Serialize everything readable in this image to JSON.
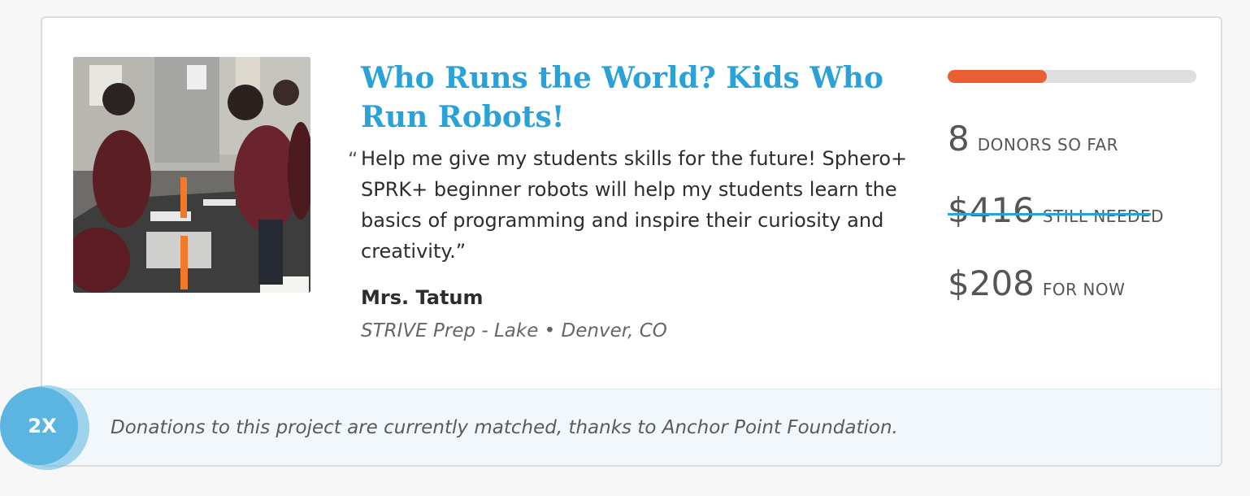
{
  "project": {
    "title": "Who Runs the World? Kids Who Run Robots!",
    "quote_open": "“",
    "quote": "Help me give my students skills for the future! Sphero+ SPRK+ beginner robots will help my students learn the basics of programming and inspire their curiosity and creativity.”",
    "teacher": "Mrs. Tatum",
    "school": "STRIVE Prep - Lake • Denver, CO",
    "photo_icon": "classroom-photo"
  },
  "funding": {
    "progress_fraction": 0.4,
    "progress_color": "#ea5e34",
    "donors_count": "8",
    "donors_label": "DONORS SO FAR",
    "needed_amount": "$416",
    "needed_label": "STILL NEEDED",
    "now_amount": "$208",
    "now_label": "FOR NOW"
  },
  "match": {
    "badge": "2X",
    "text": "Donations to this project are currently matched, thanks to Anchor Point Foundation."
  },
  "colors": {
    "accent": "#2aa2d8",
    "badge": "#5cb5e1"
  }
}
